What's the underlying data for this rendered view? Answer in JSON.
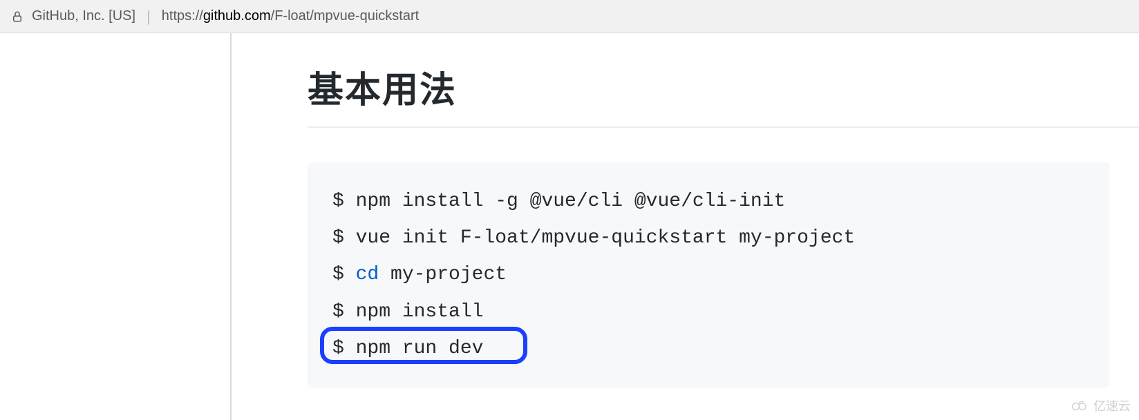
{
  "addressBar": {
    "siteIdentity": "GitHub, Inc. [US]",
    "urlPrefix": "https://",
    "urlDomain": "github.com",
    "urlPath": "/F-loat/mpvue-quickstart"
  },
  "page": {
    "heading": "基本用法"
  },
  "code": {
    "lines": [
      {
        "prompt": "$ ",
        "text": "npm install -g @vue/cli @vue/cli-init",
        "keyword": ""
      },
      {
        "prompt": "$ ",
        "text": "vue init F-loat/mpvue-quickstart my-project",
        "keyword": ""
      },
      {
        "prompt": "$ ",
        "text": " my-project",
        "keyword": "cd"
      },
      {
        "prompt": "$ ",
        "text": "npm install",
        "keyword": ""
      },
      {
        "prompt": "$ ",
        "text": "npm run dev",
        "keyword": ""
      }
    ]
  },
  "watermark": {
    "text": "亿速云"
  }
}
